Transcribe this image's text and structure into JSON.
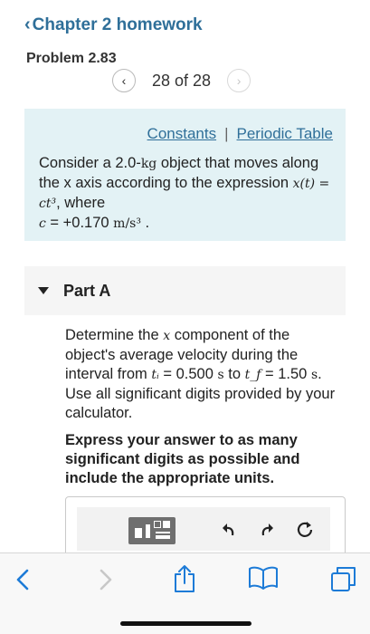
{
  "header": {
    "chapter_chevron": "‹",
    "chapter_link": "Chapter 2 homework",
    "problem_title": "Problem 2.83"
  },
  "pager": {
    "prev_glyph": "‹",
    "next_glyph": "›",
    "position_text": "28 of 28"
  },
  "info": {
    "link_constants": "Constants",
    "separator": "|",
    "link_periodic": "Periodic Table",
    "text_1": "Consider a 2.0-",
    "text_unit_kg": "kg",
    "text_2": " object that moves along the x axis according to the expression ",
    "text_expr": "x(t) = ct³",
    "text_3": ", where",
    "text_c": "c",
    "text_4": " = +0.170 ",
    "text_unit_c": "m/s³",
    "text_5": " ."
  },
  "part_a": {
    "label": "Part A",
    "q_1": "Determine the ",
    "q_x": "x",
    "q_2": " component of the object's average velocity during the interval from ",
    "q_ti": "tᵢ",
    "q_3": " = 0.500 ",
    "q_s1": "s",
    "q_4": " to ",
    "q_tf": "t_f",
    "q_5": " = 1.50 ",
    "q_s2": "s",
    "q_6": ". Use all significant digits provided by your calculator.",
    "instruction": "Express your answer to as many significant digits as possible and include the appropriate units."
  },
  "toolbar": {
    "icons": [
      "templates-icon",
      "undo-icon",
      "redo-icon",
      "reset-icon"
    ]
  },
  "browser_bar": {
    "icons": [
      "back-icon",
      "forward-icon",
      "share-icon",
      "bookmarks-icon",
      "tabs-icon"
    ]
  },
  "colors": {
    "link": "#2f6f99",
    "info_bg": "#e3f2f5",
    "part_bg": "#f5f5f5",
    "toolbar_bg": "#f2f2f2"
  }
}
